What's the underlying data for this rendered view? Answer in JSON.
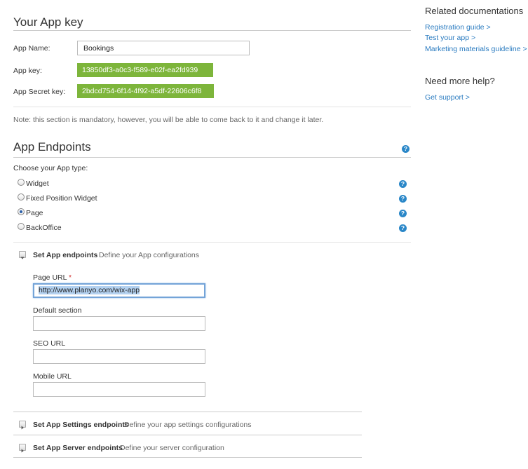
{
  "app_key_section": {
    "title": "Your App key",
    "app_name_label": "App Name:",
    "app_name_value": "Bookings",
    "app_key_label": "App key:",
    "app_key_value": "13850df3-a0c3-f589-e02f-ea2fd939",
    "app_secret_label": "App Secret key:",
    "app_secret_value": "2bdcd754-6f14-4f92-a5df-22606c6f8",
    "note": "Note: this section is mandatory, however, you will be able to come back to it and change it later."
  },
  "endpoints_section": {
    "title": "App Endpoints",
    "choose_label": "Choose your App type:",
    "app_types": [
      {
        "label": "Widget",
        "selected": false
      },
      {
        "label": "Fixed Position Widget",
        "selected": false
      },
      {
        "label": "Page",
        "selected": true
      },
      {
        "label": "BackOffice",
        "selected": false
      }
    ],
    "set_app_endpoints": {
      "title": "Set App endpoints",
      "description": "Define your App configurations",
      "expanded": true,
      "page_url_label": "Page URL",
      "required_mark": "*",
      "page_url_value": "http://www.planyo.com/wix-app",
      "default_section_label": "Default section",
      "default_section_value": "",
      "seo_url_label": "SEO URL",
      "seo_url_value": "",
      "mobile_url_label": "Mobile URL",
      "mobile_url_value": ""
    },
    "set_settings_endpoints": {
      "title": "Set App Settings endpoints",
      "description": "Define your app settings configurations",
      "expanded": false
    },
    "set_server_endpoints": {
      "title": "Set App Server endpoints",
      "description": "Define your server configuration",
      "expanded": false
    }
  },
  "sidebar": {
    "related_title": "Related documentations",
    "links": [
      "Registration guide >",
      "Test your app >",
      "Marketing materials guideline >"
    ],
    "help_title": "Need more help?",
    "support_link": "Get support >"
  },
  "icons": {
    "help": "?",
    "collapse": "triangle-down-icon",
    "expand": "triangle-right-icon"
  },
  "colors": {
    "key_bg": "#7db53b",
    "link": "#2a7bc0",
    "help_icon": "#2a87c8"
  }
}
